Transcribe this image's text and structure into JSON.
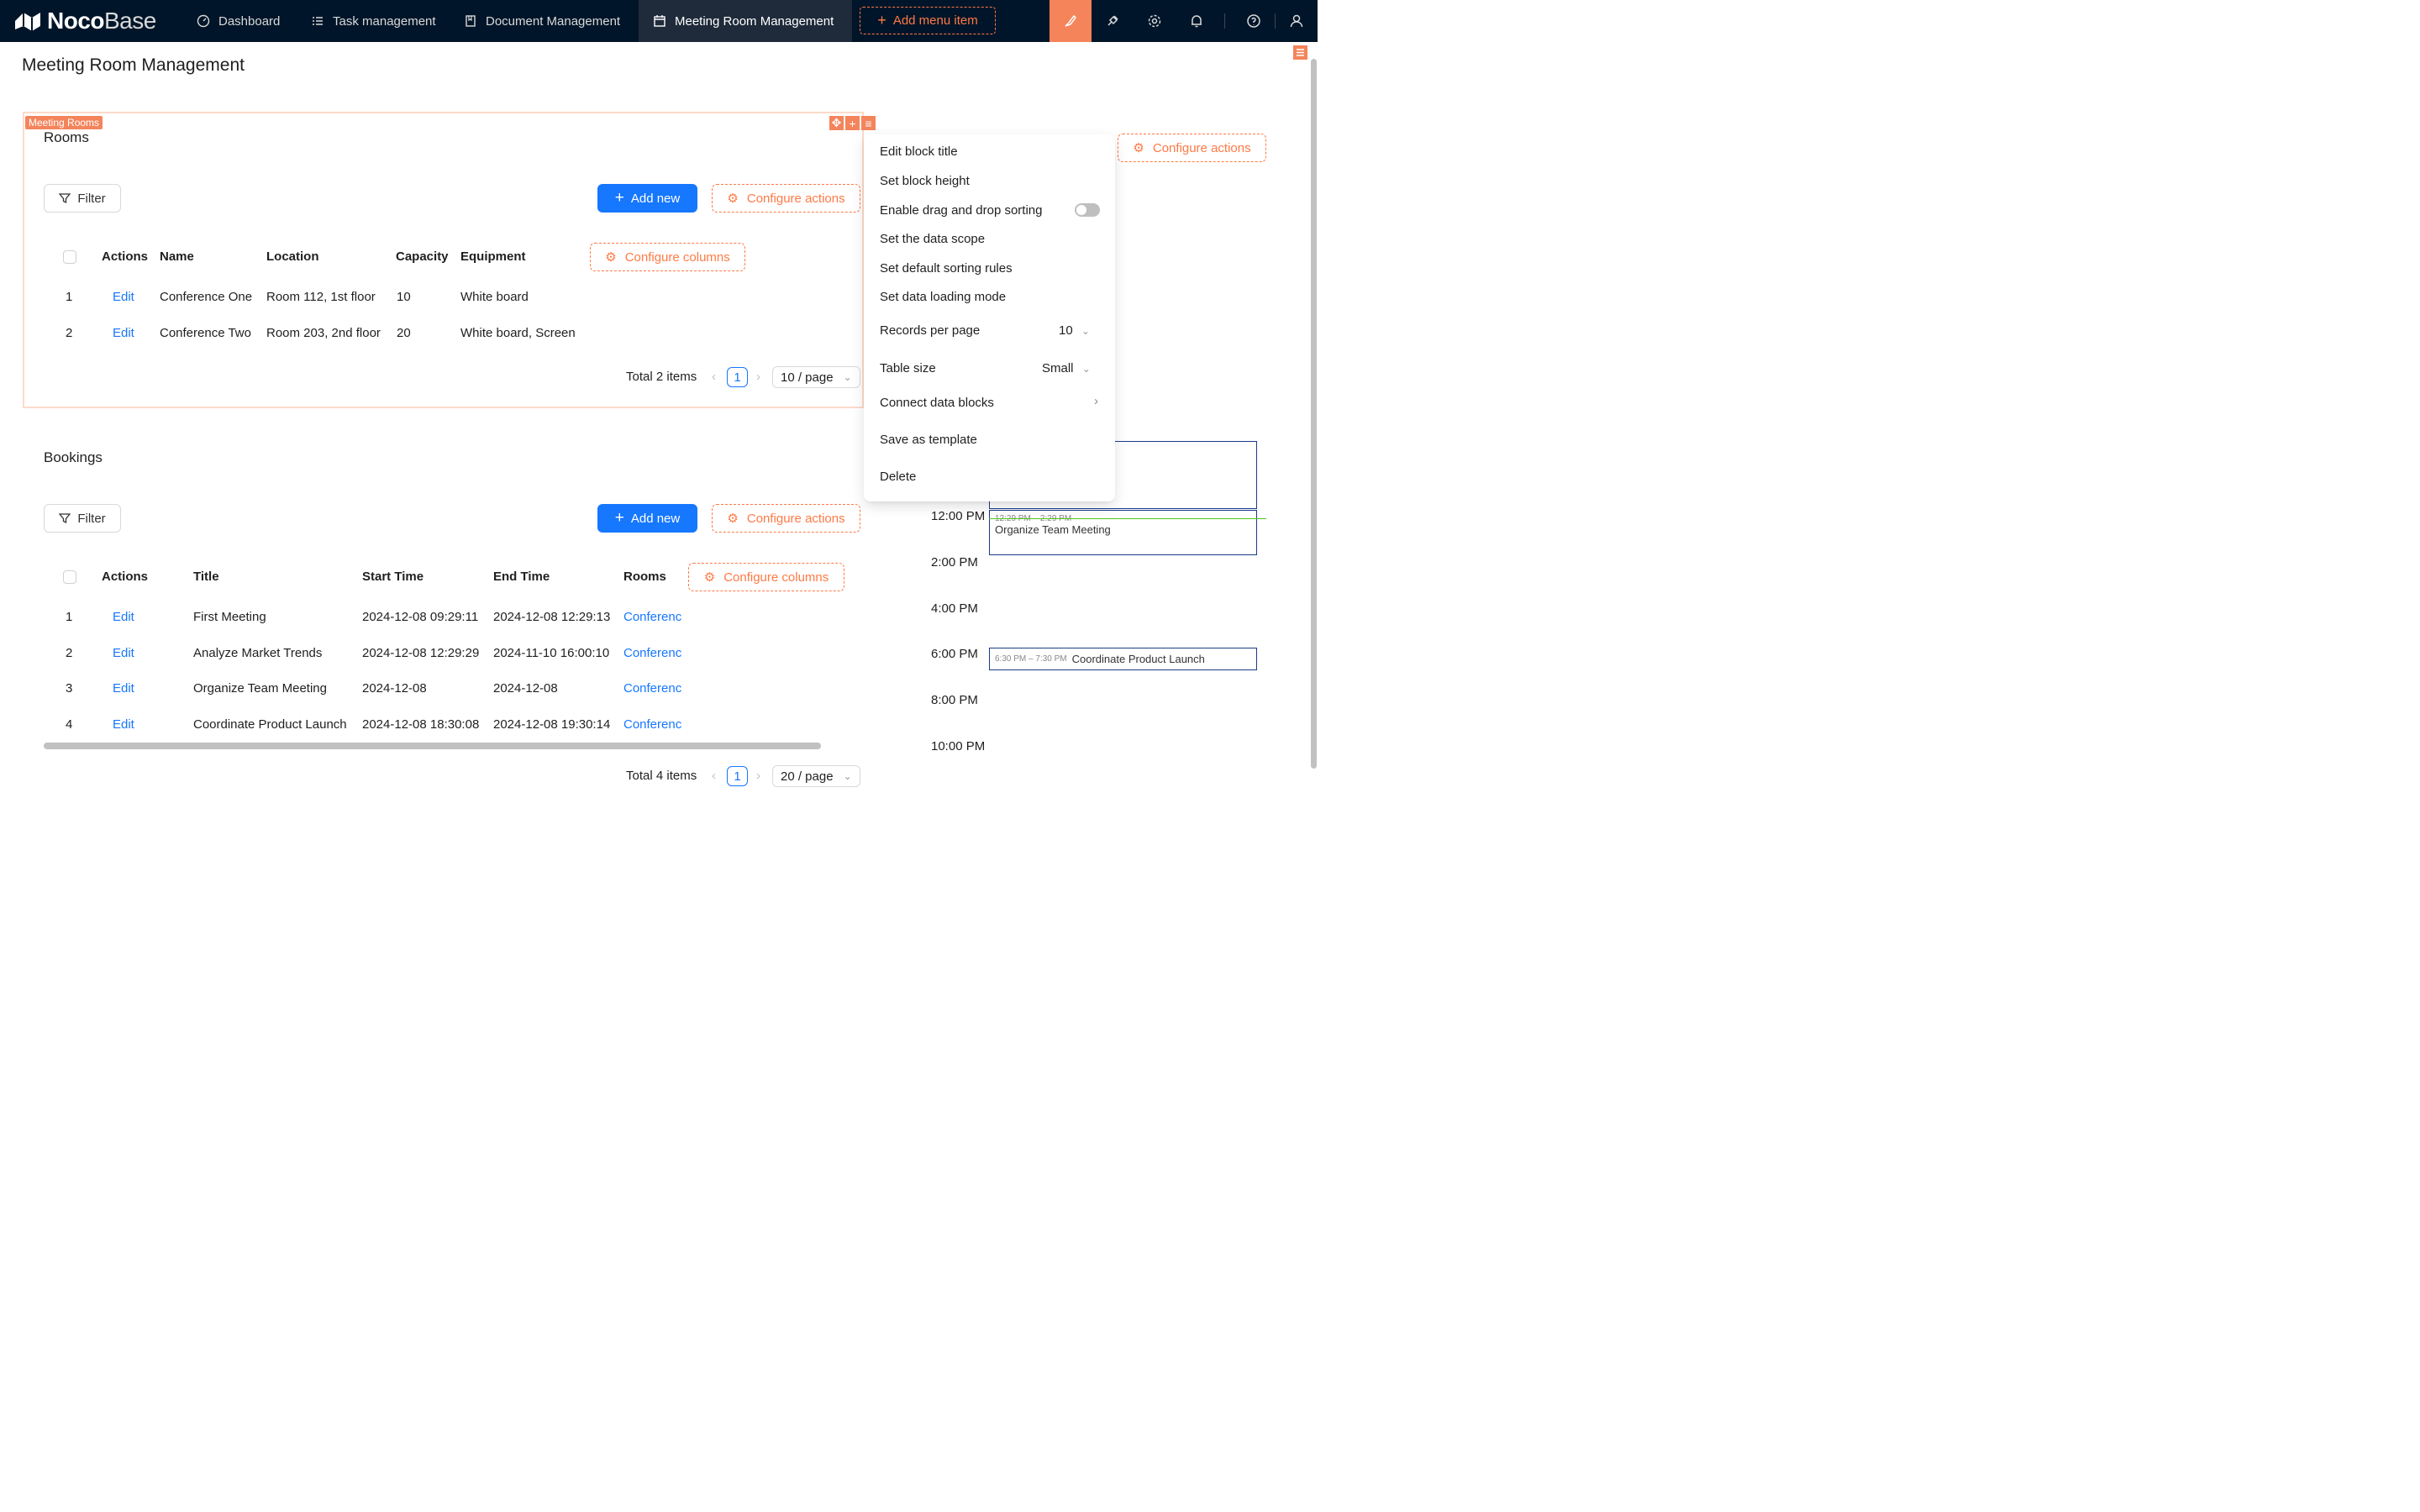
{
  "app": {
    "logo_bold": "Noco",
    "logo_light": "Base"
  },
  "nav": {
    "items": [
      {
        "label": "Dashboard",
        "icon": "dashboard-icon"
      },
      {
        "label": "Task management",
        "icon": "list-icon"
      },
      {
        "label": "Document Management",
        "icon": "book-icon"
      },
      {
        "label": "Meeting Room Management",
        "icon": "calendar-icon",
        "active": true
      }
    ],
    "add_menu_item": "Add menu item",
    "icons": [
      "design-mode-icon",
      "plugin-icon",
      "settings-icon",
      "bell-icon",
      "help-icon",
      "user-icon"
    ]
  },
  "page": {
    "title": "Meeting Room Management"
  },
  "rooms_block": {
    "tag": "Meeting Rooms",
    "title": "Rooms",
    "filter_label": "Filter",
    "add_new_label": "Add new",
    "configure_actions_label": "Configure actions",
    "configure_columns_label": "Configure columns",
    "columns": [
      "Actions",
      "Name",
      "Location",
      "Capacity",
      "Equipment"
    ],
    "rows": [
      {
        "index": "1",
        "action": "Edit",
        "name": "Conference One",
        "location": "Room 112, 1st floor",
        "capacity": "10",
        "equipment": "White board"
      },
      {
        "index": "2",
        "action": "Edit",
        "name": "Conference Two",
        "location": "Room 203, 2nd floor",
        "capacity": "20",
        "equipment": "White board, Screen"
      }
    ],
    "pagination": {
      "total": "Total 2 items",
      "page": "1",
      "page_size": "10 / page"
    }
  },
  "bookings_block": {
    "title": "Bookings",
    "filter_label": "Filter",
    "add_new_label": "Add new",
    "configure_actions_label": "Configure actions",
    "configure_columns_label": "Configure columns",
    "columns": [
      "Actions",
      "Title",
      "Start Time",
      "End Time",
      "Rooms"
    ],
    "rows": [
      {
        "index": "1",
        "action": "Edit",
        "title": "First Meeting",
        "start": "2024-12-08 09:29:11",
        "end": "2024-12-08 12:29:13",
        "rooms": "Conferenc"
      },
      {
        "index": "2",
        "action": "Edit",
        "title": "Analyze Market Trends",
        "start": "2024-12-08 12:29:29",
        "end": "2024-11-10 16:00:10",
        "rooms": "Conferenc"
      },
      {
        "index": "3",
        "action": "Edit",
        "title": "Organize Team Meeting",
        "start": "2024-12-08",
        "end": "2024-12-08",
        "rooms": "Conferenc"
      },
      {
        "index": "4",
        "action": "Edit",
        "title": "Coordinate Product Launch",
        "start": "2024-12-08 18:30:08",
        "end": "2024-12-08 19:30:14",
        "rooms": "Conferenc"
      }
    ],
    "pagination": {
      "total": "Total 4 items",
      "page": "1",
      "page_size": "20 / page"
    }
  },
  "settings_menu": {
    "items": [
      "Edit block title",
      "Set block height",
      "Enable drag and drop sorting",
      "Set the data scope",
      "Set default sorting rules",
      "Set data loading mode",
      "Records per page",
      "Table size",
      "Connect data blocks",
      "Save as template",
      "Delete"
    ],
    "records_per_page_value": "10",
    "table_size_value": "Small",
    "drag_sort_enabled": false
  },
  "calendar": {
    "configure_actions_label": "Configure actions",
    "times": [
      "12:00 PM",
      "2:00 PM",
      "4:00 PM",
      "6:00 PM",
      "8:00 PM",
      "10:00 PM"
    ],
    "events": [
      {
        "time": "12:29 PM – 2:29 PM",
        "title": "Organize Team Meeting"
      },
      {
        "time": "6:30 PM – 7:30 PM",
        "title": "Coordinate Product Launch"
      }
    ],
    "now_line_color": "#52c41a"
  },
  "colors": {
    "topbar": "#001529",
    "accent_orange": "#ff7a45",
    "primary_blue": "#1677ff"
  }
}
